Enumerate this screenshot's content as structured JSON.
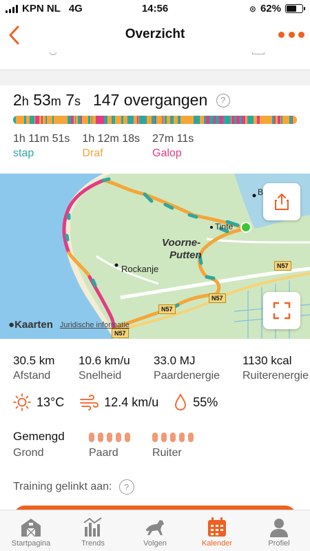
{
  "status": {
    "carrier": "KPN NL",
    "network": "4G",
    "time": "14:56",
    "battery": "62%",
    "battery_level": 0.62
  },
  "nav": {
    "title": "Overzicht"
  },
  "summary": {
    "duration": {
      "h": "2",
      "h_unit": "h",
      "m": "53",
      "m_unit": "m",
      "s": "7",
      "s_unit": "s"
    },
    "transitions": "147 overgangen",
    "help": "?"
  },
  "gaits": [
    {
      "time": "1h 11m 51s",
      "label": "stap",
      "color": "#2ea6a0"
    },
    {
      "time": "1h 12m 18s",
      "label": "Draf",
      "color": "#f4a63a"
    },
    {
      "time": "27m 11s",
      "label": "Galop",
      "color": "#e23c84"
    }
  ],
  "map": {
    "places": {
      "voorne": "Voorne-",
      "putten": "Putten",
      "rockanje": "Rockanje",
      "tinte": "Tinte",
      "b": "B"
    },
    "roads": [
      "N57",
      "N57",
      "N57",
      "N57"
    ],
    "logo": "Kaarten",
    "legal": "Juridische informatie"
  },
  "stats": [
    {
      "value": "30.5 km",
      "label": "Afstand"
    },
    {
      "value": "10.6 km/u",
      "label": "Snelheid"
    },
    {
      "value": "33.0 MJ",
      "label": "Paardenergie"
    },
    {
      "value": "1130 kcal",
      "label": "Ruiterenergie"
    }
  ],
  "weather": {
    "temperature": "13°C",
    "wind": "12.4 km/u",
    "humidity": "55%"
  },
  "ground": {
    "value": "Gemengd",
    "label": "Grond"
  },
  "horse": {
    "label": "Paard"
  },
  "rider": {
    "label": "Ruiter"
  },
  "linked": {
    "label": "Training gelinkt aan:",
    "help": "?"
  },
  "tabs": [
    {
      "label": "Startpagina",
      "icon": "barn-icon"
    },
    {
      "label": "Trends",
      "icon": "chart-icon"
    },
    {
      "label": "Volgen",
      "icon": "horse-icon"
    },
    {
      "label": "Kalender",
      "icon": "calendar-icon",
      "active": true
    },
    {
      "label": "Profiel",
      "icon": "profile-icon"
    }
  ],
  "colors": {
    "accent": "#f06022",
    "walk": "#2ea6a0",
    "trot": "#f4a63a",
    "canter": "#e23c84"
  }
}
